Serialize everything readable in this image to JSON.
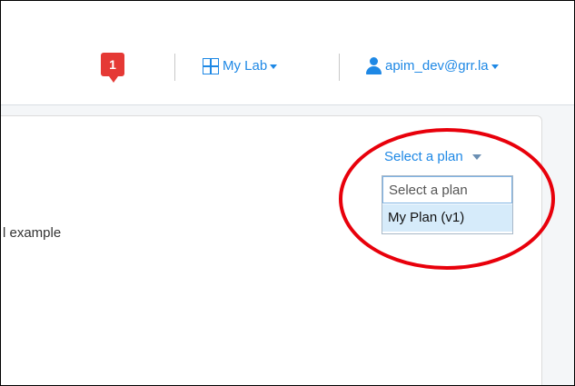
{
  "header": {
    "notification_count": "1",
    "my_lab_label": "My Lab",
    "user_label": "apim_dev@grr.la",
    "accent_color": "#1e88e5",
    "badge_color": "#e53935"
  },
  "content": {
    "partial_text": "l example"
  },
  "plan_select": {
    "toggle_label": "Select a plan",
    "options": [
      "Select a plan",
      "My Plan (v1)"
    ],
    "selected": "My Plan (v1)"
  },
  "annotation": {
    "circle_color": "#e8000b"
  }
}
